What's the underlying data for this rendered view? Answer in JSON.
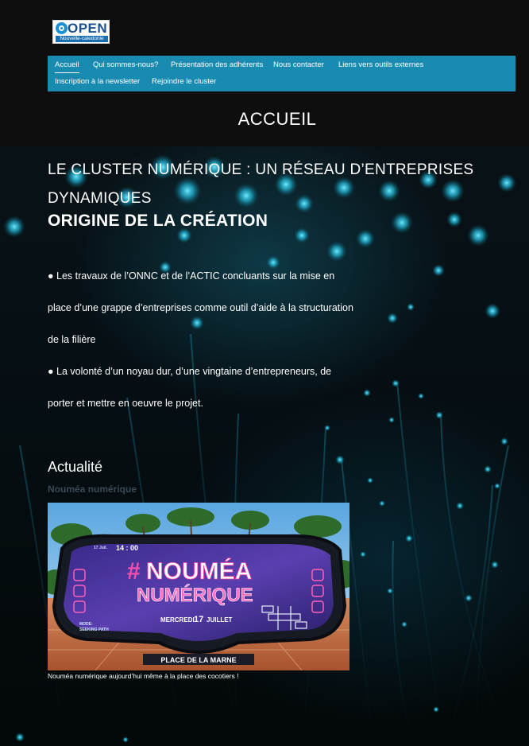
{
  "logo": {
    "word": "OPEN",
    "subtitle": "Nouvelle-caledonie"
  },
  "nav": {
    "items": [
      {
        "label": "Accueil",
        "active": true
      },
      {
        "label": "Qui sommes-nous?"
      },
      {
        "label": "Présentation des adhérents"
      },
      {
        "label": "Nous contacter"
      },
      {
        "label": "Liens vers outils externes"
      },
      {
        "label": "Inscription à la newsletter"
      },
      {
        "label": "Rejoindre le cluster"
      }
    ]
  },
  "page": {
    "heading": "ACCUEIL"
  },
  "main": {
    "cluster_heading_line1": "LE CLUSTER NUMÉRIQUE : UN RÉSEAU D’ENTREPRISES",
    "cluster_heading_line2": "DYNAMIQUES",
    "origin_heading": "ORIGINE DE LA CRÉATION",
    "paragraph_lines": [
      "● Les travaux de l’ONNC et de l’ACTIC concluants sur la mise en",
      "place d’une grappe d’entreprises comme outil d’aide à la structuration",
      "de la filière",
      "● La volonté d’un noyau dur, d’une vingtaine d’entrepreneurs, de",
      "porter et mettre en oeuvre le projet."
    ]
  },
  "news": {
    "section_heading": "Actualité",
    "item_title": "Nouméa numérique",
    "caption": "Nouméa numérique aujourd’hui même à la place des cocotiers !",
    "image": {
      "time_small": "17 Juil.",
      "time": "14 : 00",
      "hashtag": "#",
      "title_line1": "NOUMÉA",
      "title_line2": "NUMÉRIQUE",
      "date_prefix": "MERCREDI",
      "date_day": "17",
      "date_month": "JUILLET",
      "mode_label": "MODE:",
      "mode_value": "SEEKING PATH",
      "place": "PLACE DE LA MARNE"
    }
  },
  "colors": {
    "nav_bg": "#1a8bb0",
    "top_band": "#0e0e0e",
    "news_title": "#3a4a52",
    "accent_pink": "#ff3fa4",
    "accent_cyan": "#24c8e8"
  }
}
